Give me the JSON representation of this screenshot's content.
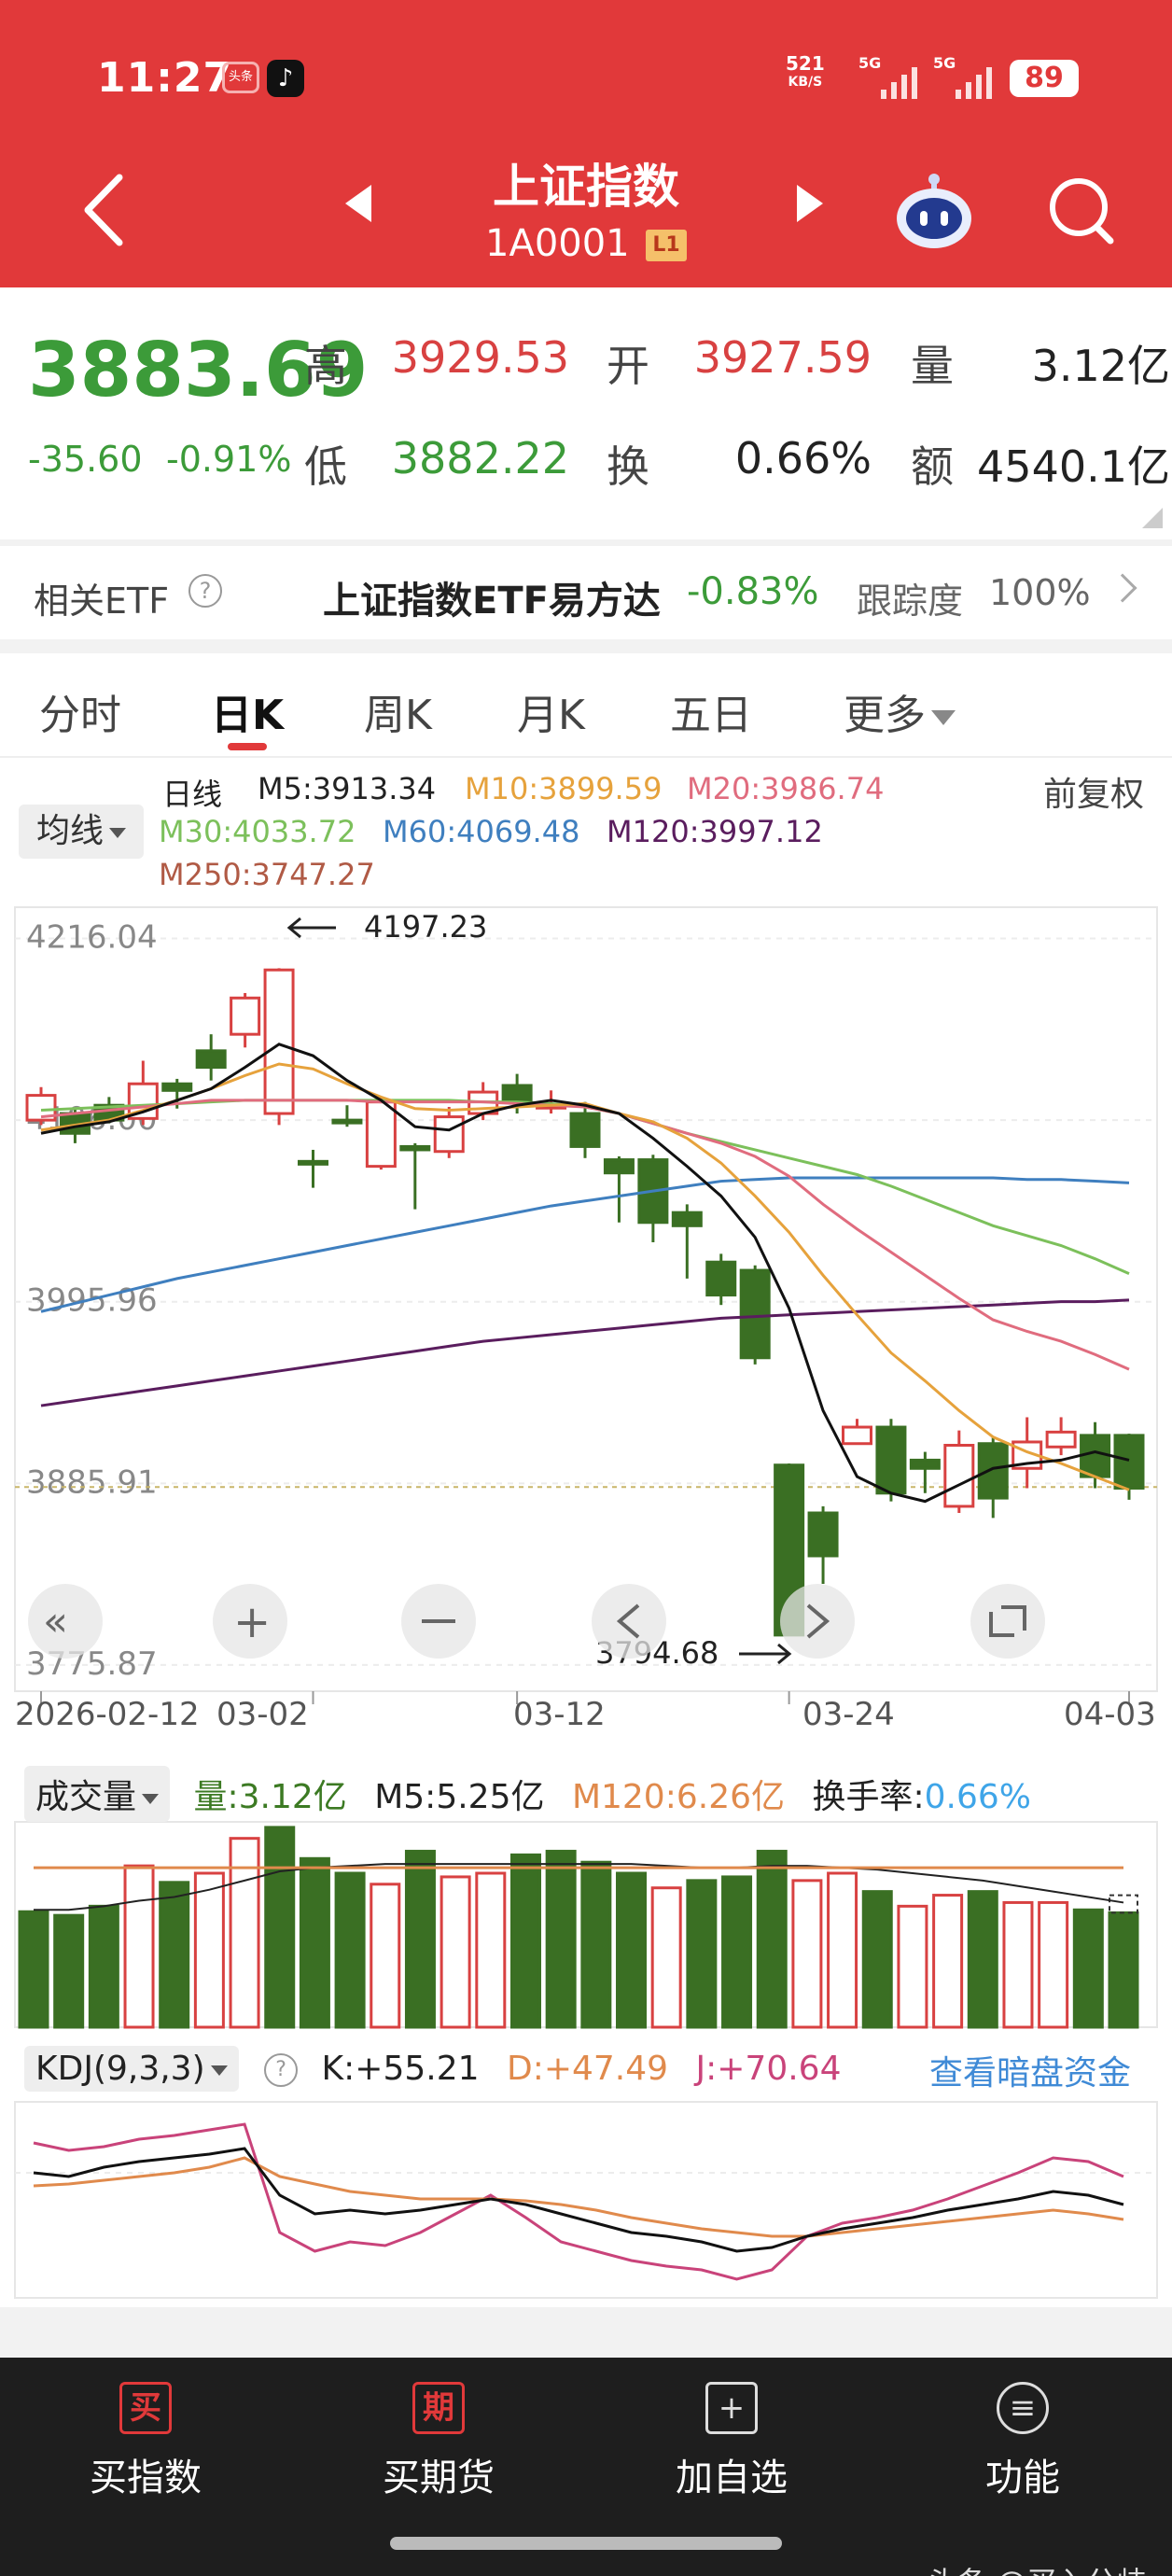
{
  "status": {
    "time": "11:27",
    "app1": "头条",
    "net_speed": "521",
    "net_unit": "KB/S",
    "sig1": "5G",
    "sig2": "5G",
    "battery": "89"
  },
  "header": {
    "title": "上证指数",
    "code": "1A0001",
    "level": "L1"
  },
  "quote": {
    "price": "3883.69",
    "change": "-35.60",
    "change_pct": "-0.91%",
    "high_label": "高",
    "high": "3929.53",
    "open_label": "开",
    "open": "3927.59",
    "vol_label": "量",
    "vol": "3.12亿",
    "low_label": "低",
    "low": "3882.22",
    "turn_label": "换",
    "turn": "0.66%",
    "amt_label": "额",
    "amt": "4540.1亿"
  },
  "etf": {
    "label": "相关ETF",
    "name": "上证指数ETF易方达",
    "pct": "-0.83%",
    "track_label": "跟踪度",
    "track": "100%"
  },
  "tabs": {
    "t0": "分时",
    "t1": "日K",
    "t2": "周K",
    "t3": "月K",
    "t4": "五日",
    "t5": "更多"
  },
  "ma": {
    "daily": "日线",
    "m5": "M5:3913.34",
    "m10": "M10:3899.59",
    "m20": "M20:3986.74",
    "m30": "M30:4033.72",
    "m60": "M60:4069.48",
    "m120": "M120:3997.12",
    "m250": "M250:3747.27",
    "select": "均线",
    "fq": "前复权"
  },
  "chart_data": {
    "type": "candlestick",
    "y_ticks": [
      "4216.04",
      "4106.00",
      "3995.96",
      "3885.91",
      "3775.87"
    ],
    "x_ticks": [
      "2026-02-12",
      "03-02",
      "03-12",
      "03-24",
      "04-03"
    ],
    "high_annot": "4197.23",
    "low_annot": "3794.68",
    "candles": [
      [
        4106,
        4121,
        4103,
        4126
      ],
      [
        4110,
        4098,
        4092,
        4113
      ],
      [
        4115,
        4106,
        4104,
        4120
      ],
      [
        4107,
        4128,
        4103,
        4142
      ],
      [
        4128,
        4124,
        4113,
        4131
      ],
      [
        4148,
        4138,
        4130,
        4158
      ],
      [
        4158,
        4180,
        4150,
        4183
      ],
      [
        4110,
        4197,
        4103,
        4198
      ],
      [
        4081,
        4080,
        4065,
        4088
      ],
      [
        4106,
        4105,
        4102,
        4115
      ],
      [
        4078,
        4117,
        4076,
        4120
      ],
      [
        4090,
        4088,
        4052,
        4092
      ],
      [
        4087,
        4108,
        4083,
        4114
      ],
      [
        4110,
        4123,
        4106,
        4129
      ],
      [
        4127,
        4118,
        4110,
        4134
      ],
      [
        4115,
        4115,
        4110,
        4124
      ],
      [
        4110,
        4090,
        4083,
        4117
      ],
      [
        4082,
        4074,
        4044,
        4084
      ],
      [
        4082,
        4044,
        4032,
        4085
      ],
      [
        4050,
        4042,
        4010,
        4055
      ],
      [
        4020,
        4000,
        3994,
        4025
      ],
      [
        4015,
        3962,
        3958,
        4018
      ],
      [
        3897,
        3794,
        3794,
        3898
      ],
      [
        3868,
        3842,
        3825,
        3872
      ],
      [
        3910,
        3920,
        3910,
        3925
      ],
      [
        3920,
        3880,
        3875,
        3925
      ],
      [
        3900,
        3895,
        3880,
        3905
      ],
      [
        3872,
        3909,
        3868,
        3918
      ],
      [
        3910,
        3877,
        3865,
        3914
      ],
      [
        3895,
        3911,
        3883,
        3926
      ],
      [
        3908,
        3917,
        3903,
        3926
      ],
      [
        3915,
        3890,
        3883,
        3923
      ],
      [
        3915,
        3883,
        3876,
        3916
      ]
    ],
    "ma5": [
      4098,
      4102,
      4105,
      4111,
      4118,
      4125,
      4138,
      4152,
      4145,
      4130,
      4118,
      4102,
      4100,
      4110,
      4115,
      4118,
      4115,
      4110,
      4095,
      4078,
      4060,
      4035,
      3992,
      3930,
      3890,
      3880,
      3875,
      3885,
      3895,
      3898,
      3900,
      3905,
      3900
    ],
    "ma10": [
      4100,
      4103,
      4106,
      4112,
      4118,
      4125,
      4133,
      4140,
      4137,
      4128,
      4120,
      4113,
      4112,
      4113,
      4114,
      4115,
      4116,
      4110,
      4105,
      4095,
      4080,
      4060,
      4038,
      4012,
      3988,
      3965,
      3948,
      3930,
      3914,
      3905,
      3898,
      3890,
      3882
    ],
    "ma20": [
      4108,
      4110,
      4112,
      4114,
      4116,
      4118,
      4118,
      4118,
      4118,
      4118,
      4117,
      4117,
      4117,
      4117,
      4116,
      4115,
      4114,
      4110,
      4104,
      4098,
      4092,
      4084,
      4072,
      4055,
      4040,
      4026,
      4012,
      3998,
      3985,
      3978,
      3972,
      3964,
      3955
    ],
    "ma30": [
      4112,
      4113,
      4114,
      4115,
      4116,
      4117,
      4118,
      4118,
      4118,
      4118,
      4118,
      4118,
      4118,
      4117,
      4117,
      4116,
      4114,
      4110,
      4104,
      4098,
      4093,
      4088,
      4083,
      4078,
      4073,
      4066,
      4058,
      4050,
      4042,
      4036,
      4030,
      4022,
      4013
    ],
    "ma60": [
      3990,
      3995,
      4000,
      4005,
      4010,
      4014,
      4018,
      4022,
      4026,
      4030,
      4034,
      4038,
      4042,
      4046,
      4050,
      4054,
      4057,
      4060,
      4063,
      4066,
      4069,
      4070,
      4071,
      4071,
      4071,
      4071,
      4071,
      4071,
      4071,
      4070,
      4070,
      4069,
      4068
    ],
    "ma120": [
      3933,
      3936,
      3939,
      3942,
      3945,
      3948,
      3951,
      3954,
      3957,
      3960,
      3963,
      3966,
      3969,
      3972,
      3974,
      3976,
      3978,
      3980,
      3982,
      3984,
      3986,
      3987,
      3988,
      3989,
      3990,
      3991,
      3992,
      3993,
      3994,
      3995,
      3996,
      3996,
      3997
    ],
    "volume": [
      {
        "v": 3.15,
        "up": false
      },
      {
        "v": 3.05,
        "up": false
      },
      {
        "v": 3.3,
        "up": false
      },
      {
        "v": 4.4,
        "up": true
      },
      {
        "v": 3.95,
        "up": false
      },
      {
        "v": 4.2,
        "up": true
      },
      {
        "v": 5.15,
        "up": true
      },
      {
        "v": 5.45,
        "up": false
      },
      {
        "v": 4.6,
        "up": false
      },
      {
        "v": 4.2,
        "up": false
      },
      {
        "v": 3.9,
        "up": true
      },
      {
        "v": 4.8,
        "up": false
      },
      {
        "v": 4.1,
        "up": true
      },
      {
        "v": 4.2,
        "up": true
      },
      {
        "v": 4.7,
        "up": false
      },
      {
        "v": 4.8,
        "up": false
      },
      {
        "v": 4.5,
        "up": false
      },
      {
        "v": 4.2,
        "up": false
      },
      {
        "v": 3.8,
        "up": true
      },
      {
        "v": 4.0,
        "up": false
      },
      {
        "v": 4.1,
        "up": false
      },
      {
        "v": 4.8,
        "up": false
      },
      {
        "v": 4.0,
        "up": true
      },
      {
        "v": 4.2,
        "up": true
      },
      {
        "v": 3.7,
        "up": false
      },
      {
        "v": 3.3,
        "up": true
      },
      {
        "v": 3.6,
        "up": true
      },
      {
        "v": 3.7,
        "up": false
      },
      {
        "v": 3.4,
        "up": true
      },
      {
        "v": 3.4,
        "up": true
      },
      {
        "v": 3.2,
        "up": false
      },
      {
        "v": 3.12,
        "up": false
      }
    ],
    "vol_ma": [
      3.2,
      3.2,
      3.3,
      3.45,
      3.55,
      3.75,
      4.0,
      4.25,
      4.35,
      4.4,
      4.45,
      4.45,
      4.45,
      4.45,
      4.45,
      4.45,
      4.45,
      4.45,
      4.4,
      4.35,
      4.35,
      4.4,
      4.4,
      4.35,
      4.3,
      4.2,
      4.1,
      4.0,
      3.85,
      3.7,
      3.55,
      3.4
    ],
    "vol_label": "成交量",
    "vol_text": "量:3.12亿",
    "vol_m5": "M5:5.25亿",
    "vol_m120": "M120:6.26亿",
    "vol_turn_label": "换手率:",
    "vol_turn": "0.66%",
    "kdj_label": "KDJ(9,3,3)",
    "k_text": "K:+55.21",
    "d_text": "D:+47.49",
    "j_text": "J:+70.64",
    "link": "查看暗盘资金",
    "k": [
      72,
      70,
      75,
      78,
      80,
      82,
      85,
      60,
      50,
      52,
      50,
      52,
      55,
      58,
      55,
      50,
      45,
      40,
      38,
      35,
      30,
      32,
      38,
      42,
      45,
      48,
      52,
      55,
      58,
      62,
      60,
      55
    ],
    "d": [
      65,
      66,
      68,
      70,
      72,
      75,
      80,
      70,
      66,
      62,
      60,
      58,
      58,
      58,
      57,
      55,
      52,
      48,
      45,
      42,
      40,
      38,
      38,
      40,
      42,
      44,
      46,
      48,
      50,
      52,
      50,
      47
    ],
    "j": [
      88,
      84,
      86,
      90,
      92,
      95,
      98,
      40,
      30,
      35,
      33,
      40,
      50,
      60,
      48,
      35,
      30,
      25,
      22,
      20,
      15,
      20,
      38,
      45,
      48,
      52,
      58,
      65,
      72,
      80,
      78,
      70
    ]
  },
  "nav": {
    "n0_icon": "买",
    "n0": "买指数",
    "n1_icon": "期",
    "n1": "买期货",
    "n2_icon": "+",
    "n2": "加自选",
    "n3_icon": "≡",
    "n3": "功能"
  },
  "watermark": "头条 @买入分歧"
}
